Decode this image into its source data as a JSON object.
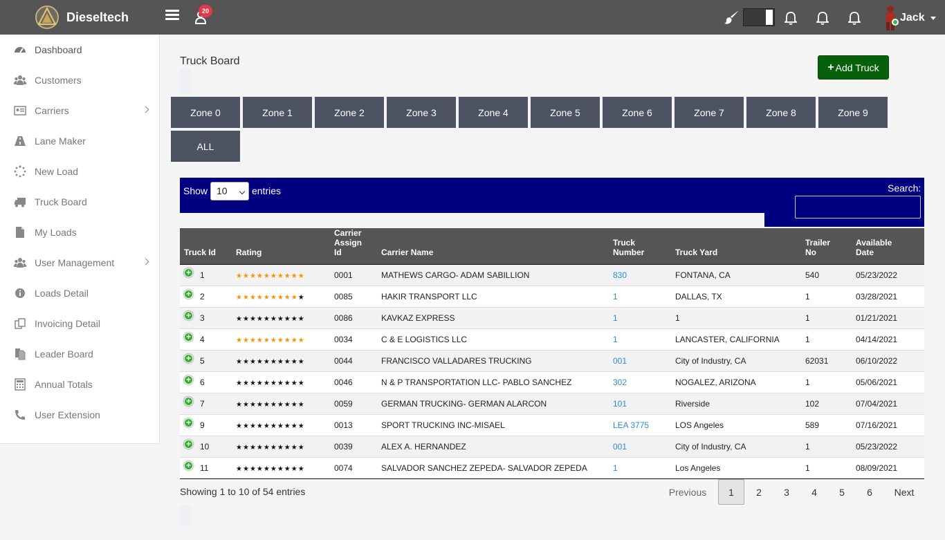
{
  "header": {
    "app_name": "Dieseltech",
    "notification_count": "20",
    "user_name": "Jack"
  },
  "sidebar": {
    "items": [
      {
        "label": "Dashboard",
        "icon": "dashboard-icon",
        "has_submenu": false
      },
      {
        "label": "Customers",
        "icon": "users-icon",
        "has_submenu": false
      },
      {
        "label": "Carriers",
        "icon": "id-card-icon",
        "has_submenu": true
      },
      {
        "label": "Lane Maker",
        "icon": "road-icon",
        "has_submenu": false
      },
      {
        "label": "New Load",
        "icon": "spinner-icon",
        "has_submenu": false
      },
      {
        "label": "Truck Board",
        "icon": "truck-icon",
        "has_submenu": false
      },
      {
        "label": "My Loads",
        "icon": "file-icon",
        "has_submenu": false
      },
      {
        "label": "User Management",
        "icon": "users-icon",
        "has_submenu": true
      },
      {
        "label": "Loads Detail",
        "icon": "info-icon",
        "has_submenu": false
      },
      {
        "label": "Invoicing Detail",
        "icon": "copy-icon",
        "has_submenu": false
      },
      {
        "label": "Leader Board",
        "icon": "files-icon",
        "has_submenu": false
      },
      {
        "label": "Annual Totals",
        "icon": "calculator-icon",
        "has_submenu": false
      },
      {
        "label": "User Extension",
        "icon": "phone-icon",
        "has_submenu": false
      }
    ]
  },
  "main": {
    "title": "Truck Board",
    "add_button_label": "Add Truck",
    "zones": [
      "Zone 0",
      "Zone 1",
      "Zone 2",
      "Zone 3",
      "Zone 4",
      "Zone 5",
      "Zone 6",
      "Zone 7",
      "Zone 8",
      "Zone 9",
      "ALL"
    ]
  },
  "table_controls": {
    "show_label": "Show",
    "entries_value": "10",
    "entries_label": "entries",
    "search_label": "Search:",
    "search_value": ""
  },
  "table": {
    "columns": [
      "Truck Id",
      "Rating",
      "Carrier Assign Id",
      "Carrier Name",
      "Truck Number",
      "Truck Yard",
      "Trailer No",
      "Available Date"
    ],
    "rows": [
      {
        "id": "1",
        "stars": 10,
        "assign": "0001",
        "name": "MATHEWS CARGO- ADAM SABILLION",
        "truck_number": "830",
        "yard": "FONTANA, CA",
        "trailer": "540",
        "date": "05/23/2022"
      },
      {
        "id": "2",
        "stars": 9,
        "assign": "0085",
        "name": "HAKIR TRANSPORT LLC",
        "truck_number": "1",
        "yard": "DALLAS, TX",
        "trailer": "1",
        "date": "03/28/2021"
      },
      {
        "id": "3",
        "stars": 0,
        "assign": "0086",
        "name": "KAVKAZ EXPRESS",
        "truck_number": "1",
        "yard": "1",
        "trailer": "1",
        "date": "01/21/2021"
      },
      {
        "id": "4",
        "stars": 10,
        "assign": "0034",
        "name": "C & E LOGISTICS LLC",
        "truck_number": "1",
        "yard": "LANCASTER, CALIFORNIA",
        "trailer": "1",
        "date": "04/14/2021"
      },
      {
        "id": "5",
        "stars": 0,
        "assign": "0044",
        "name": "FRANCISCO VALLADARES TRUCKING",
        "truck_number": "001",
        "yard": "City of Industry, CA",
        "trailer": "62031",
        "date": "06/10/2022"
      },
      {
        "id": "6",
        "stars": 0,
        "assign": "0046",
        "name": "N & P TRANSPORTATION LLC- PABLO SANCHEZ",
        "truck_number": "302",
        "yard": "NOGALEZ, ARIZONA",
        "trailer": "1",
        "date": "05/06/2021"
      },
      {
        "id": "7",
        "stars": 0,
        "assign": "0059",
        "name": "GERMAN TRUCKING- GERMAN ALARCON",
        "truck_number": "101",
        "yard": "Riverside",
        "trailer": "102",
        "date": "07/04/2021"
      },
      {
        "id": "9",
        "stars": 0,
        "assign": "0013",
        "name": "SPORT TRUCKING INC-MISAEL",
        "truck_number": "LEA 3775",
        "yard": "LOS Angeles",
        "trailer": "589",
        "date": "07/16/2021"
      },
      {
        "id": "10",
        "stars": 0,
        "assign": "0039",
        "name": "ALEX A. HERNANDEZ",
        "truck_number": "001",
        "yard": "City of Industry, CA",
        "trailer": "1",
        "date": "05/23/2022"
      },
      {
        "id": "11",
        "stars": 0,
        "assign": "0074",
        "name": "SALVADOR SANCHEZ ZEPEDA- SALVADOR ZEPEDA",
        "truck_number": "1",
        "yard": "Los Angeles",
        "trailer": "1",
        "date": "08/09/2021"
      }
    ]
  },
  "footer": {
    "info": "Showing 1 to 10 of 54 entries",
    "previous_label": "Previous",
    "pages": [
      "1",
      "2",
      "3",
      "4",
      "5",
      "6"
    ],
    "current_page": "1",
    "next_label": "Next"
  },
  "colors": {
    "topbar": "#555555",
    "zone_button": "#4d5363",
    "table_controls_bg": "#000080",
    "add_button": "#07610a",
    "star_on": "#f79500",
    "link": "#2c8bd4"
  }
}
